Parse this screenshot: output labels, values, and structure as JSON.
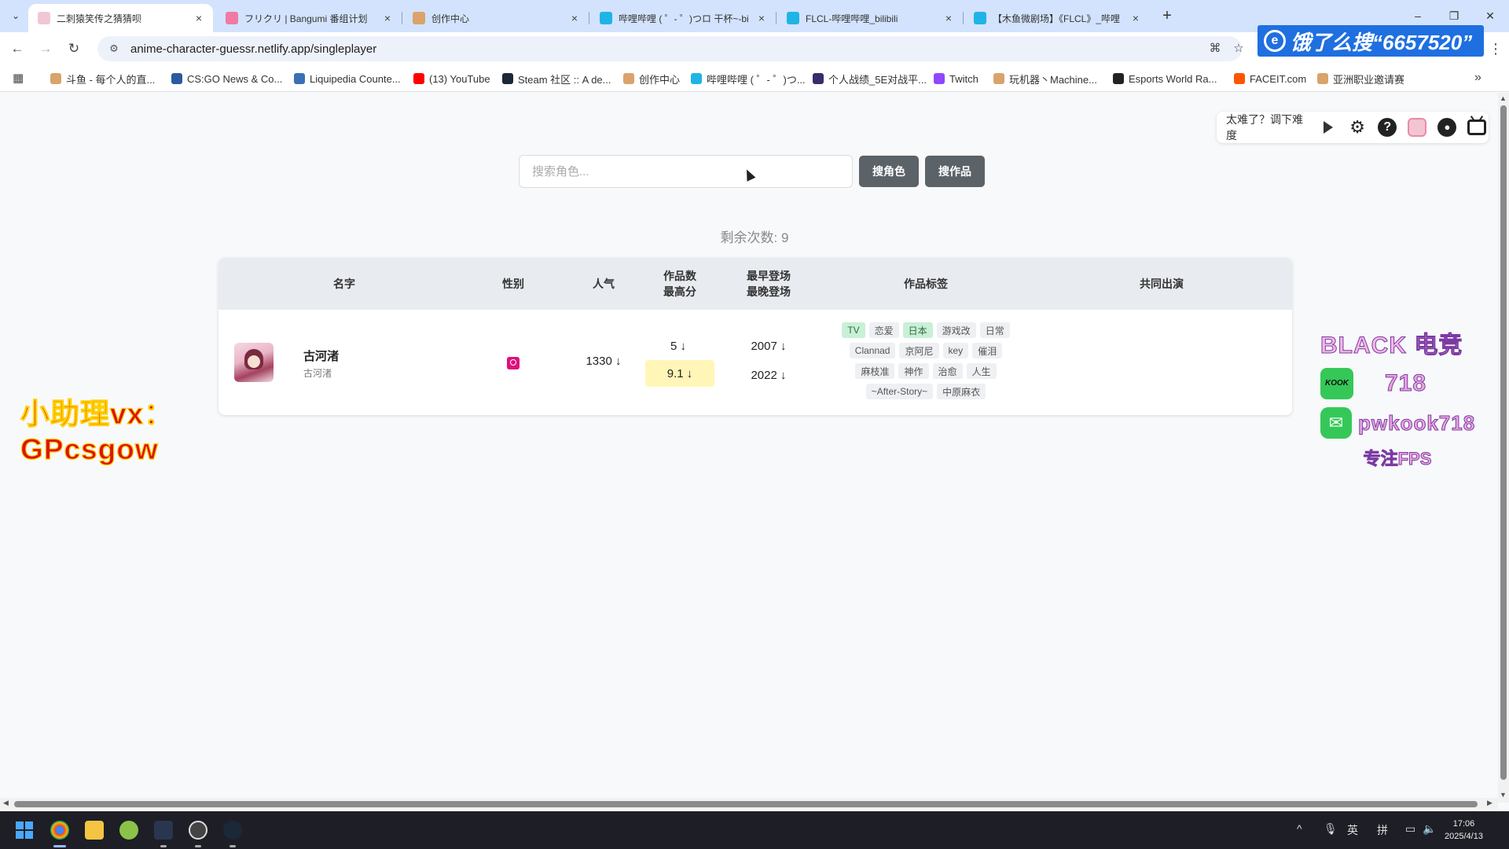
{
  "browser": {
    "tabs": [
      {
        "title": "二刺猿笑传之猜猜呗",
        "color": "#f1c6d6"
      },
      {
        "title": "フリクリ | Bangumi 番组计划",
        "color": "#f07aa4"
      },
      {
        "title": "创作中心",
        "color": "#d9a36b"
      },
      {
        "title": "哔哩哔哩 ( ゜- ゜)つロ 干杯~-bi",
        "color": "#1fb4e6"
      },
      {
        "title": "FLCL-哔哩哔哩_bilibili",
        "color": "#1fb4e6"
      },
      {
        "title": "【木鱼微剧场】《FLCL》_哔哩",
        "color": "#1fb4e6"
      }
    ],
    "close_glyph": "×",
    "new_tab_glyph": "+",
    "window_controls": [
      "–",
      "❐",
      "✕"
    ],
    "nav": {
      "back": "←",
      "forward": "→",
      "reload": "↻"
    },
    "url": "anime-character-guessr.netlify.app/singleplayer",
    "ad_text": "饿了么搜“6657520”",
    "bookmarks": [
      {
        "label": "斗鱼 - 每个人的直...",
        "color": "#d9a36b"
      },
      {
        "label": "CS:GO News & Co...",
        "color": "#2c5aa0"
      },
      {
        "label": "Liquipedia Counte...",
        "color": "#3b6fb6"
      },
      {
        "label": "(13) YouTube",
        "color": "#ff0000"
      },
      {
        "label": "Steam 社区 :: A de...",
        "color": "#1b2838"
      },
      {
        "label": "创作中心",
        "color": "#d9a36b"
      },
      {
        "label": "哔哩哔哩 ( ゜- ゜)つ...",
        "color": "#1fb4e6"
      },
      {
        "label": "个人战绩_5E对战平...",
        "color": "#3a2b6b"
      },
      {
        "label": "Twitch",
        "color": "#9146ff"
      },
      {
        "label": "玩机器丶Machine...",
        "color": "#d9a36b"
      },
      {
        "label": "Esports World Ra...",
        "color": "#222222"
      },
      {
        "label": "FACEIT.com",
        "color": "#ff5500"
      },
      {
        "label": "亚洲职业邀请赛",
        "color": "#d9a36b"
      }
    ],
    "bookmarks_more": "»"
  },
  "page": {
    "difficulty_hint": "太难了？调下难度",
    "search": {
      "placeholder": "搜索角色...",
      "search_character_label": "搜角色",
      "search_work_label": "搜作品"
    },
    "remaining_label": "剩余次数: 9",
    "table": {
      "headers": {
        "name": "名字",
        "gender": "性别",
        "popularity": "人气",
        "works_count": "作品数",
        "top_score": "最高分",
        "earliest": "最早登场",
        "latest": "最晚登场",
        "tags": "作品标签",
        "shared": "共同出演"
      },
      "rows": [
        {
          "name": "古河渚",
          "alt_name": "古河渚",
          "gender": "female",
          "popularity": "1330 ↓",
          "works_count": "5 ↓",
          "top_score": "9.1 ↓",
          "earliest": "2007 ↓",
          "latest": "2022 ↓",
          "tags": [
            {
              "text": "TV",
              "highlight": true
            },
            {
              "text": "恋爱",
              "highlight": false
            },
            {
              "text": "日本",
              "highlight": true
            },
            {
              "text": "游戏改",
              "highlight": false
            },
            {
              "text": "日常",
              "highlight": false
            },
            {
              "text": "Clannad",
              "highlight": false
            },
            {
              "text": "京阿尼",
              "highlight": false
            },
            {
              "text": "key",
              "highlight": false
            },
            {
              "text": "催泪",
              "highlight": false
            },
            {
              "text": "麻枝准",
              "highlight": false
            },
            {
              "text": "神作",
              "highlight": false
            },
            {
              "text": "治愈",
              "highlight": false
            },
            {
              "text": "人生",
              "highlight": false
            },
            {
              "text": "~After-Story~",
              "highlight": false
            },
            {
              "text": "中原麻衣",
              "highlight": false
            }
          ],
          "shared": ""
        }
      ]
    }
  },
  "overlays": {
    "left_line1": "小助理vx：",
    "left_line2": "GPcsgow",
    "right_title": "BLACK 电竞",
    "right_kook_badge": "KOOK",
    "right_kook_id": "718",
    "right_wechat": "pwkook718",
    "right_footer": "专注FPS"
  },
  "taskbar": {
    "tray_lang": "英",
    "tray_ime": "拼",
    "time": "17:06",
    "date": "2025/4/13"
  }
}
